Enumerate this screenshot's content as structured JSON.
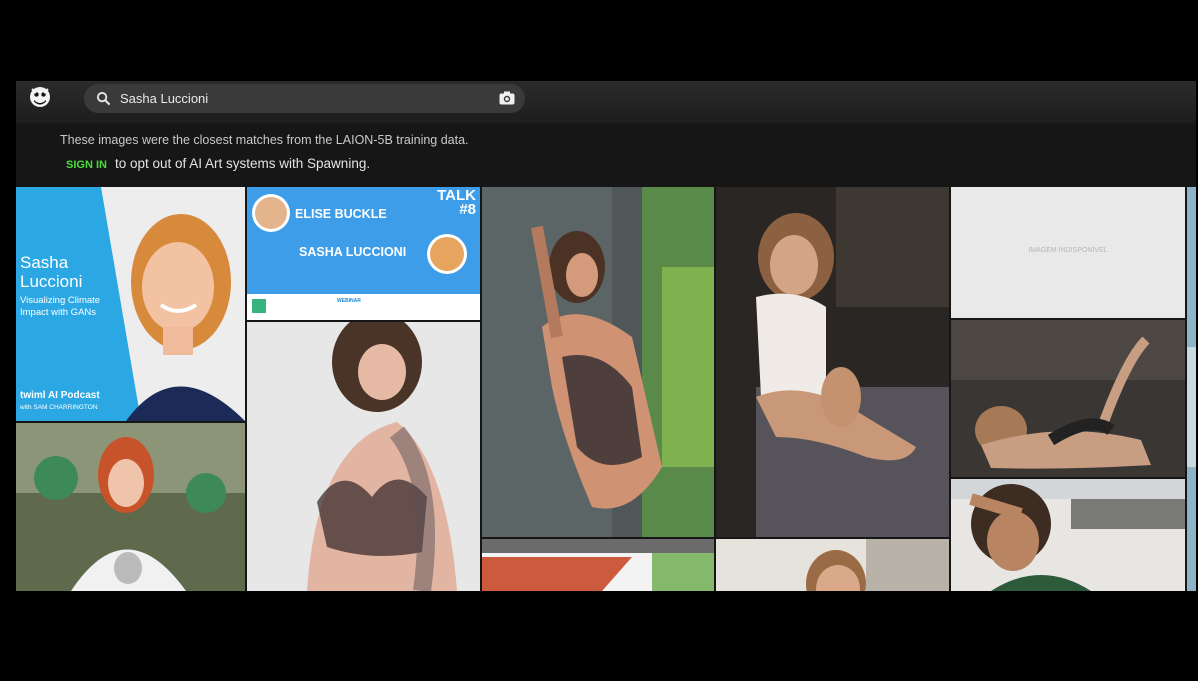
{
  "search": {
    "value": "Sasha Luccioni",
    "placeholder": ""
  },
  "notice": {
    "line1": "These images were the closest matches from the LAION-5B training data.",
    "sign_in": "SIGN IN",
    "line2_rest": "to opt out of AI Art systems with Spawning."
  },
  "colors": {
    "accent": "#4ade3a",
    "topbar": "#262626",
    "page_bg": "#000000",
    "podcast_blue": "#29a7e4"
  },
  "icons": {
    "logo": "spawning-face-icon",
    "search": "search-icon",
    "camera": "camera-icon"
  },
  "tiles": {
    "podcast": {
      "name": "Sasha\nLuccioni",
      "subtitle": "Visualizing Climate Impact with GANs",
      "brand": "twiml AI Podcast",
      "host": "with SAM CHARRINGTON"
    },
    "webinar": {
      "talk": "TALK\n#8",
      "speaker1": "ELISE BUCKLE",
      "speaker2": "SASHA LUCCIONI",
      "label": "WEBINAR"
    },
    "unavailable_text": "IMAGEM INDISPONÍVEL"
  }
}
